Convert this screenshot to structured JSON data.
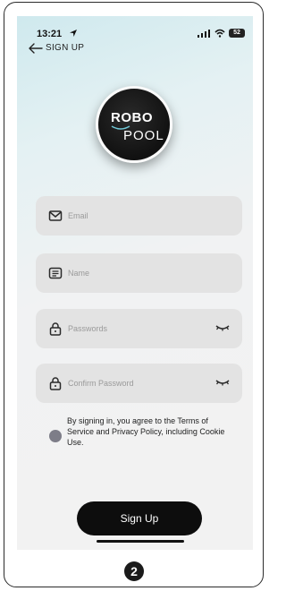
{
  "status_bar": {
    "time": "13:21",
    "battery": "52"
  },
  "header": {
    "title": "SIGN UP"
  },
  "logo": {
    "line1": "ROBO",
    "line2": "POOL"
  },
  "fields": {
    "email": {
      "placeholder": "Email",
      "icon": "mail-icon"
    },
    "name": {
      "placeholder": "Name",
      "icon": "id-card-icon"
    },
    "password": {
      "placeholder": "Passwords",
      "icon": "lock-icon",
      "toggle_icon": "eye-closed-icon"
    },
    "confirm_password": {
      "placeholder": "Confirm Password",
      "icon": "lock-icon",
      "toggle_icon": "eye-closed-icon"
    }
  },
  "terms": {
    "text": "By signing in, you agree to the Terms of Service and Privacy Policy, including Cookie Use."
  },
  "signup_button": {
    "label": "Sign Up"
  },
  "step_badge": {
    "label": "2"
  },
  "colors": {
    "button": "#0d0d0d",
    "field": "#e3e3e3",
    "radio": "#7d7d88"
  }
}
